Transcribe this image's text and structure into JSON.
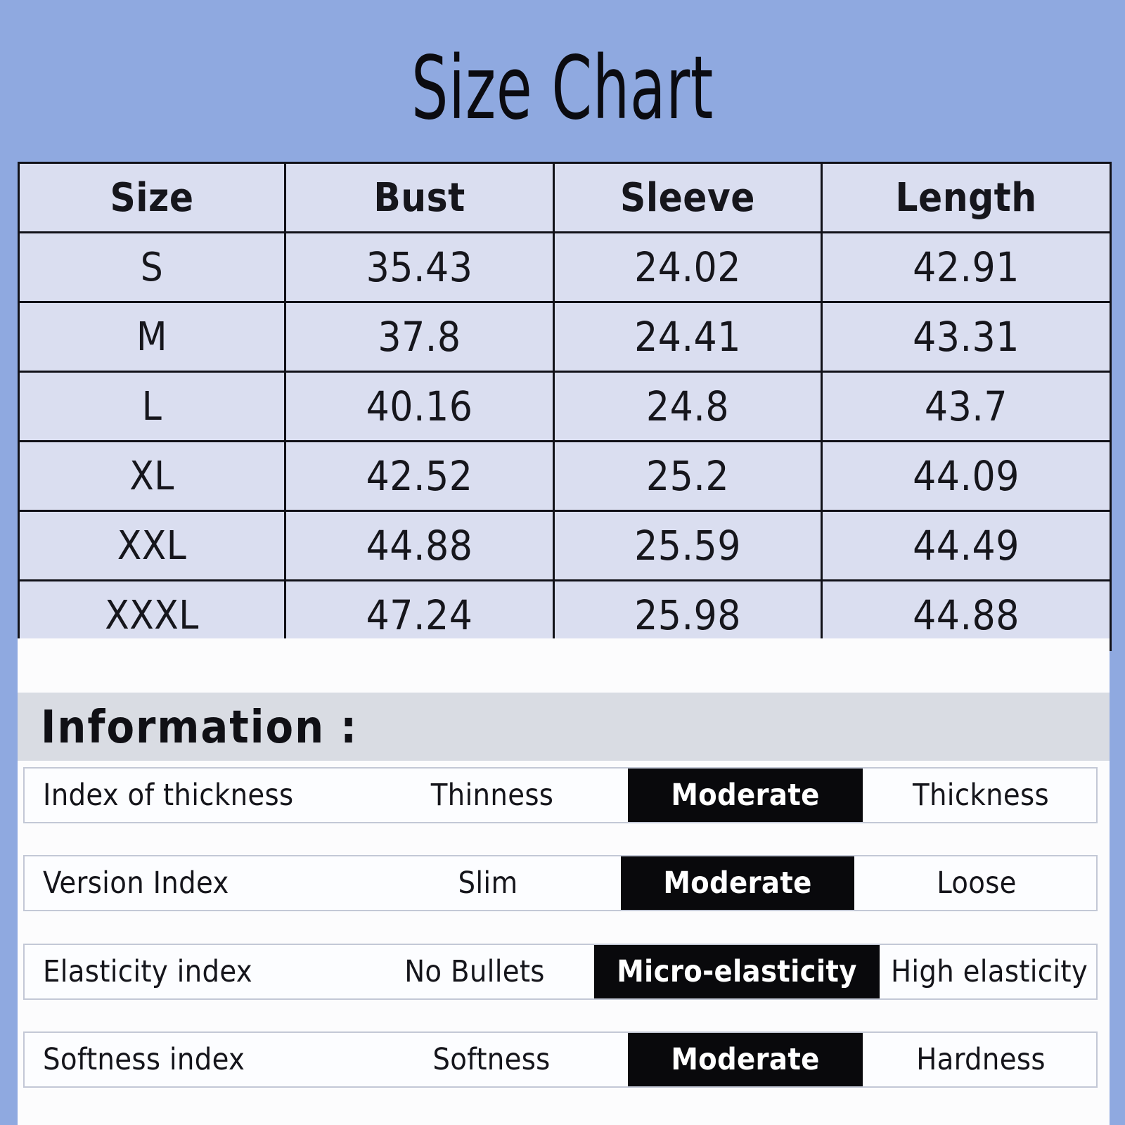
{
  "title": "Size Chart",
  "colors": {
    "background": "#8FA9E0",
    "table_cell": "#DADEF0",
    "table_border": "#111118",
    "panel": "#FCFCFD",
    "heading_band": "#D9DCE3",
    "highlight_bg": "#09090C",
    "highlight_text": "#FFFFFF"
  },
  "chart_data": {
    "type": "table",
    "title": "Size Chart",
    "columns": [
      "Size",
      "Bust",
      "Sleeve",
      "Length"
    ],
    "rows": [
      [
        "S",
        "35.43",
        "24.02",
        "42.91"
      ],
      [
        "M",
        "37.8",
        "24.41",
        "43.31"
      ],
      [
        "L",
        "40.16",
        "24.8",
        "43.7"
      ],
      [
        "XL",
        "42.52",
        "25.2",
        "44.09"
      ],
      [
        "XXL",
        "44.88",
        "25.59",
        "44.49"
      ],
      [
        "XXXL",
        "47.24",
        "25.98",
        "44.88"
      ]
    ],
    "series": [
      {
        "name": "Bust",
        "categories": [
          "S",
          "M",
          "L",
          "XL",
          "XXL",
          "XXXL"
        ],
        "values": [
          35.43,
          37.8,
          40.16,
          42.52,
          44.88,
          47.24
        ]
      },
      {
        "name": "Sleeve",
        "categories": [
          "S",
          "M",
          "L",
          "XL",
          "XXL",
          "XXXL"
        ],
        "values": [
          24.02,
          24.41,
          24.8,
          25.2,
          25.59,
          25.98
        ]
      },
      {
        "name": "Length",
        "categories": [
          "S",
          "M",
          "L",
          "XL",
          "XXL",
          "XXXL"
        ],
        "values": [
          42.91,
          43.31,
          43.7,
          44.09,
          44.49,
          44.88
        ]
      }
    ]
  },
  "size_table": {
    "headers": {
      "size": "Size",
      "bust": "Bust",
      "sleeve": "Sleeve",
      "length": "Length"
    },
    "rows": [
      {
        "size": "S",
        "bust": "35.43",
        "sleeve": "24.02",
        "length": "42.91"
      },
      {
        "size": "M",
        "bust": "37.8",
        "sleeve": "24.41",
        "length": "43.31"
      },
      {
        "size": "L",
        "bust": "40.16",
        "sleeve": "24.8",
        "length": "43.7"
      },
      {
        "size": "XL",
        "bust": "42.52",
        "sleeve": "25.2",
        "length": "44.09"
      },
      {
        "size": "XXL",
        "bust": "44.88",
        "sleeve": "25.59",
        "length": "44.49"
      },
      {
        "size": "XXXL",
        "bust": "47.24",
        "sleeve": "25.98",
        "length": "44.88"
      }
    ]
  },
  "information": {
    "heading": "Information :",
    "rows": [
      {
        "label": "Index of thickness",
        "low": "Thinness",
        "mid": "Moderate",
        "high": "Thickness",
        "selected": "mid"
      },
      {
        "label": "Version Index",
        "low": "Slim",
        "mid": "Moderate",
        "high": "Loose",
        "selected": "mid"
      },
      {
        "label": "Elasticity index",
        "low": "No Bullets",
        "mid": "Micro-elasticity",
        "high": "High elasticity",
        "selected": "mid"
      },
      {
        "label": "Softness index",
        "low": "Softness",
        "mid": "Moderate",
        "high": "Hardness",
        "selected": "mid"
      }
    ]
  }
}
